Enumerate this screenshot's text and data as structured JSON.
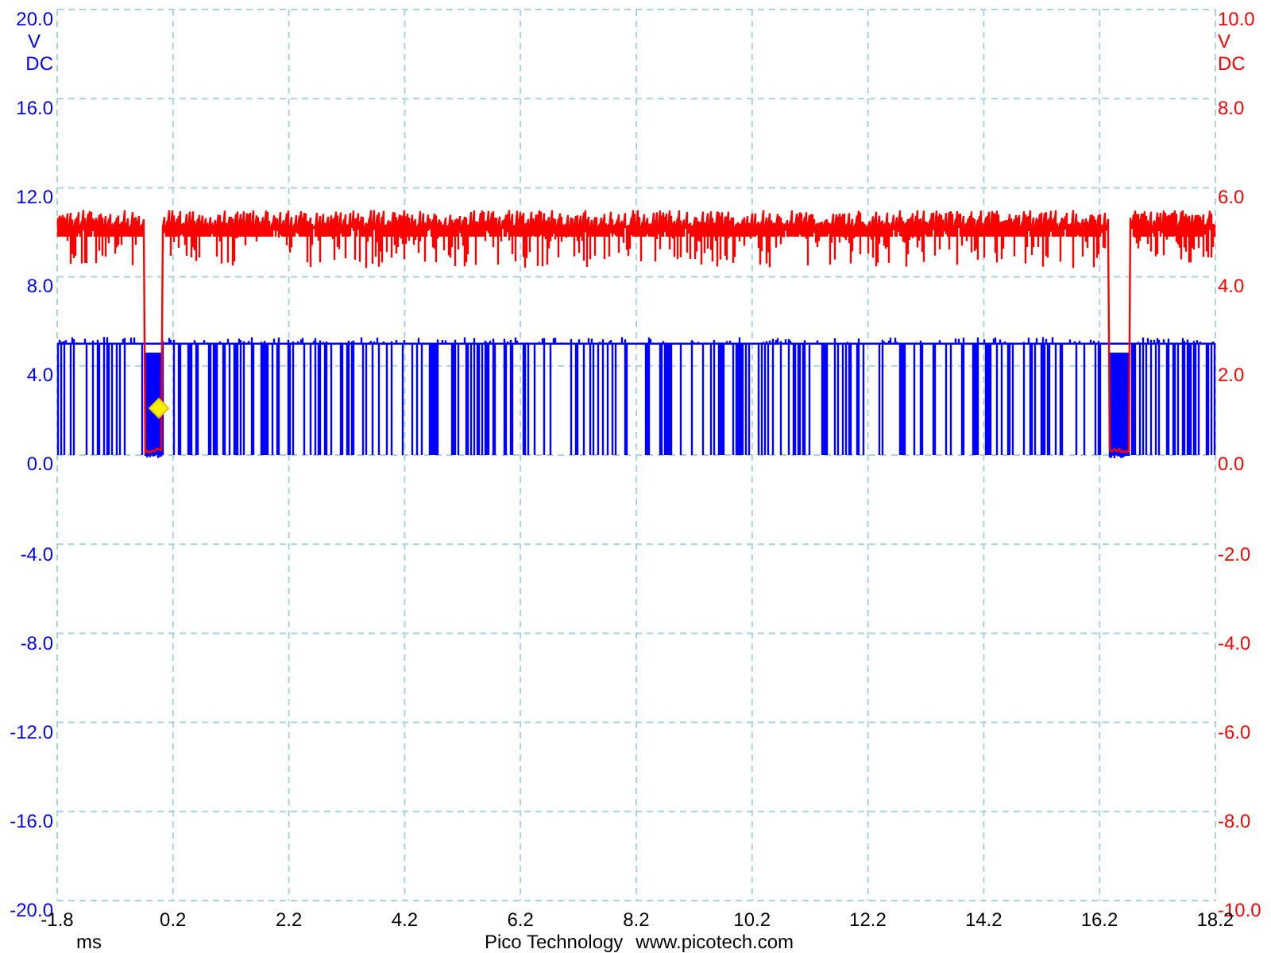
{
  "left_axis": {
    "color": "#0000ff",
    "unit": "V",
    "coupling": "DC",
    "ticks": [
      "20.0",
      "16.0",
      "12.0",
      "8.0",
      "4.0",
      "0.0",
      "-4.0",
      "-8.0",
      "-12.0",
      "-16.0",
      "-20.0"
    ]
  },
  "right_axis": {
    "color": "#ff0000",
    "unit": "V",
    "coupling": "DC",
    "ticks": [
      "10.0",
      "8.0",
      "6.0",
      "4.0",
      "2.0",
      "0.0",
      "-2.0",
      "-4.0",
      "-6.0",
      "-8.0",
      "-10.0"
    ]
  },
  "x_axis": {
    "unit": "ms",
    "ticks": [
      "-1.8",
      "0.2",
      "2.2",
      "4.2",
      "6.2",
      "8.2",
      "10.2",
      "12.2",
      "14.2",
      "16.2",
      "18.2"
    ]
  },
  "traces": [
    {
      "kind": "pulses",
      "color": "#0000ff"
    },
    {
      "kind": "noisy",
      "color": "#ff0000"
    }
  ],
  "footer": {
    "brand": "Pico Technology",
    "url": "www.picotech.com"
  }
}
